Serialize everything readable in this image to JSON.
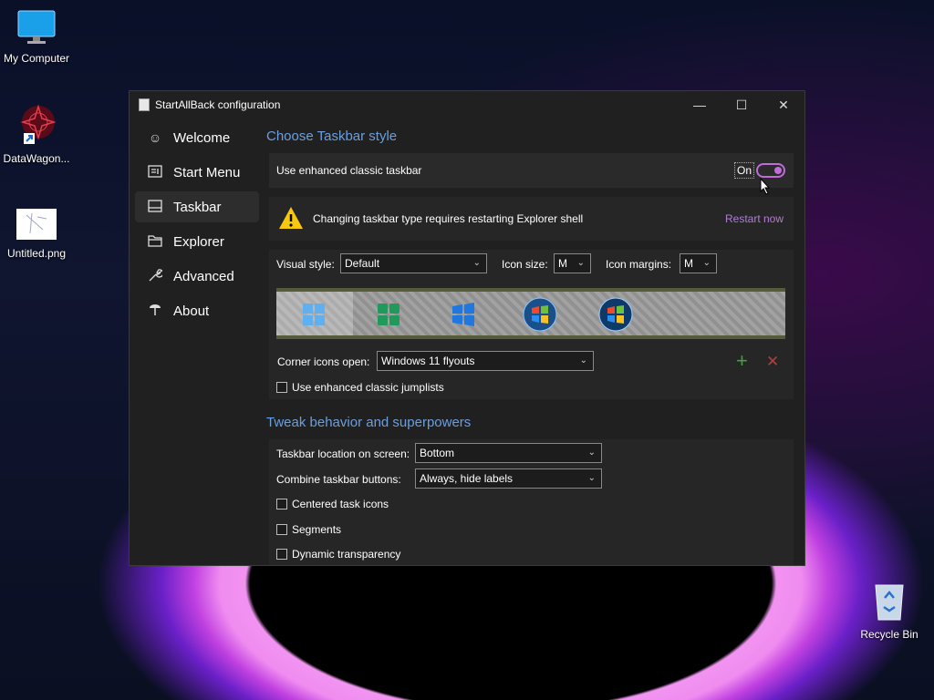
{
  "desktop": {
    "icons": [
      {
        "label": "My Computer"
      },
      {
        "label": "DataWagon..."
      },
      {
        "label": "Untitled.png"
      },
      {
        "label": "Recycle Bin"
      }
    ]
  },
  "window": {
    "title": "StartAllBack configuration",
    "controls": {
      "minimize": "—",
      "maximize": "☐",
      "close": "✕"
    }
  },
  "sidebar": {
    "items": [
      {
        "label": "Welcome",
        "icon": "smile-icon"
      },
      {
        "label": "Start Menu",
        "icon": "start-menu-icon"
      },
      {
        "label": "Taskbar",
        "icon": "taskbar-icon"
      },
      {
        "label": "Explorer",
        "icon": "folder-icon"
      },
      {
        "label": "Advanced",
        "icon": "wrench-icon"
      },
      {
        "label": "About",
        "icon": "about-icon"
      }
    ],
    "active": "Taskbar"
  },
  "taskbar_style": {
    "section_title": "Choose Taskbar style",
    "enhanced_label": "Use enhanced classic taskbar",
    "toggle_state": "On",
    "warning_text": "Changing taskbar type requires restarting Explorer shell",
    "restart_link": "Restart now",
    "visual_style_label": "Visual style:",
    "visual_style_value": "Default",
    "icon_size_label": "Icon size:",
    "icon_size_value": "M",
    "icon_margins_label": "Icon margins:",
    "icon_margins_value": "M",
    "corner_icons_label": "Corner icons open:",
    "corner_icons_value": "Windows 11 flyouts",
    "jumplists_label": "Use enhanced classic jumplists"
  },
  "tweak": {
    "section_title": "Tweak behavior and superpowers",
    "location_label": "Taskbar location on screen:",
    "location_value": "Bottom",
    "combine_label": "Combine taskbar buttons:",
    "combine_value": "Always, hide labels",
    "centered_label": "Centered task icons",
    "segments_label": "Segments",
    "dynamic_label": "Dynamic transparency"
  },
  "colors": {
    "accent": "#6a9fe0",
    "toggle": "#c06bd8",
    "link": "#b07cd8",
    "add": "#3fa33f",
    "remove": "#b04040"
  }
}
